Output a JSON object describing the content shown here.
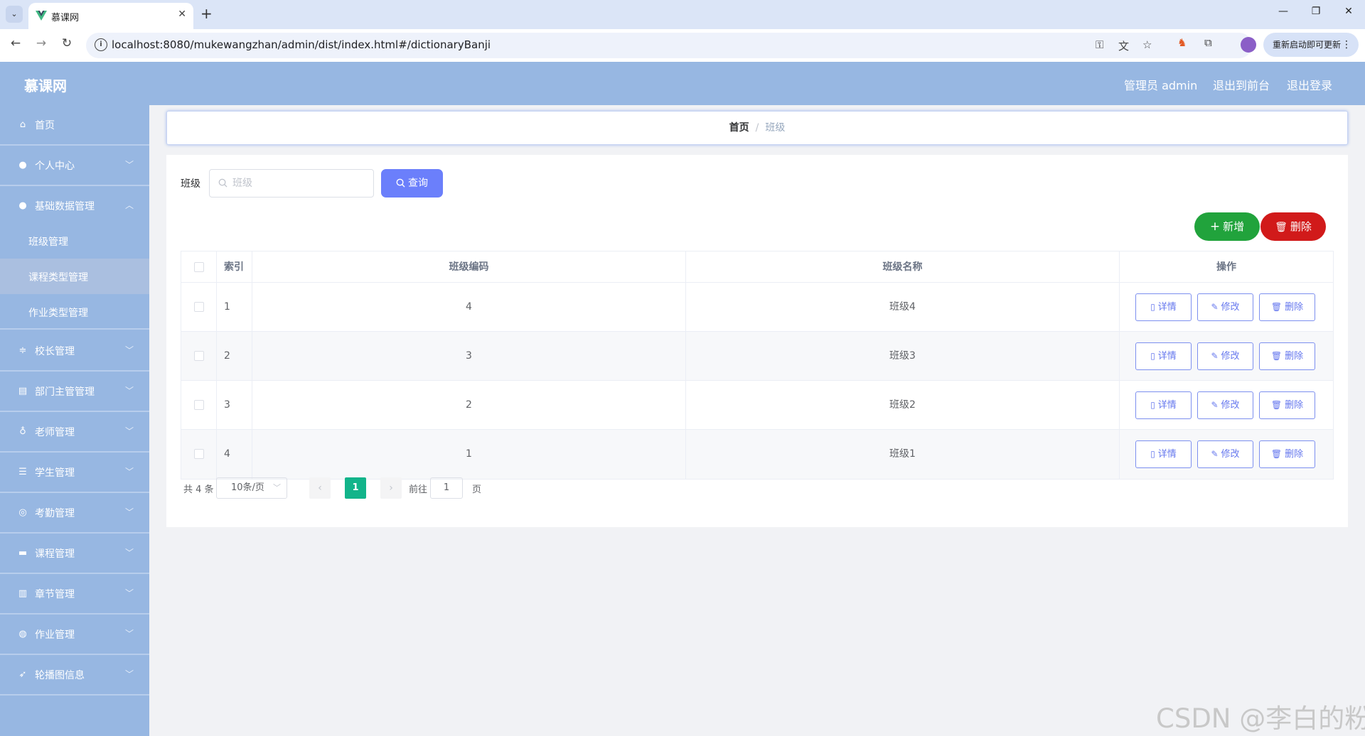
{
  "browser": {
    "tab_title": "慕课网",
    "url": "localhost:8080/mukewangzhan/admin/dist/index.html#/dictionaryBanji",
    "update_label": "重新启动即可更新"
  },
  "header": {
    "brand": "慕课网",
    "admin_label": "管理员 admin",
    "goto_front": "退出到前台",
    "logout": "退出登录"
  },
  "sidebar": {
    "items": [
      {
        "label": "首页",
        "icon": "home-icon"
      },
      {
        "label": "个人中心",
        "icon": "user-icon"
      },
      {
        "label": "基础数据管理",
        "icon": "user-icon"
      },
      {
        "label": "校长管理",
        "icon": "sliders-icon"
      },
      {
        "label": "部门主管管理",
        "icon": "clipboard-icon"
      },
      {
        "label": "老师管理",
        "icon": "microphone-icon"
      },
      {
        "label": "学生管理",
        "icon": "list-icon"
      },
      {
        "label": "考勤管理",
        "icon": "target-icon"
      },
      {
        "label": "课程管理",
        "icon": "message-icon"
      },
      {
        "label": "章节管理",
        "icon": "book-icon"
      },
      {
        "label": "作业管理",
        "icon": "globe-icon"
      },
      {
        "label": "轮播图信息",
        "icon": "send-icon"
      }
    ],
    "sub_items": [
      {
        "label": "班级管理"
      },
      {
        "label": "课程类型管理"
      },
      {
        "label": "作业类型管理"
      }
    ]
  },
  "breadcrumb": {
    "home": "首页",
    "separator": "/",
    "current": "班级"
  },
  "search": {
    "label": "班级",
    "placeholder": "班级",
    "button": "查询"
  },
  "actions": {
    "add": "新增",
    "delete": "删除"
  },
  "table": {
    "headers": {
      "index": "索引",
      "code": "班级编码",
      "name": "班级名称",
      "ops": "操作"
    },
    "rows": [
      {
        "index": "1",
        "code": "4",
        "name": "班级4"
      },
      {
        "index": "2",
        "code": "3",
        "name": "班级3"
      },
      {
        "index": "3",
        "code": "2",
        "name": "班级2"
      },
      {
        "index": "4",
        "code": "1",
        "name": "班级1"
      }
    ],
    "row_actions": {
      "detail": "详情",
      "edit": "修改",
      "delete": "删除"
    }
  },
  "pagination": {
    "total": "共 4 条",
    "page_size": "10条/页",
    "current_page": "1",
    "goto_label": "前往",
    "goto_value": "1",
    "page_suffix": "页"
  },
  "watermark": "CSDN @李白的粉",
  "colors": {
    "sidebar_bg": "#97b7e2",
    "primary": "#6b7ffb",
    "success": "#21a33c",
    "danger": "#d11a1a",
    "pager_active": "#12b48a"
  }
}
